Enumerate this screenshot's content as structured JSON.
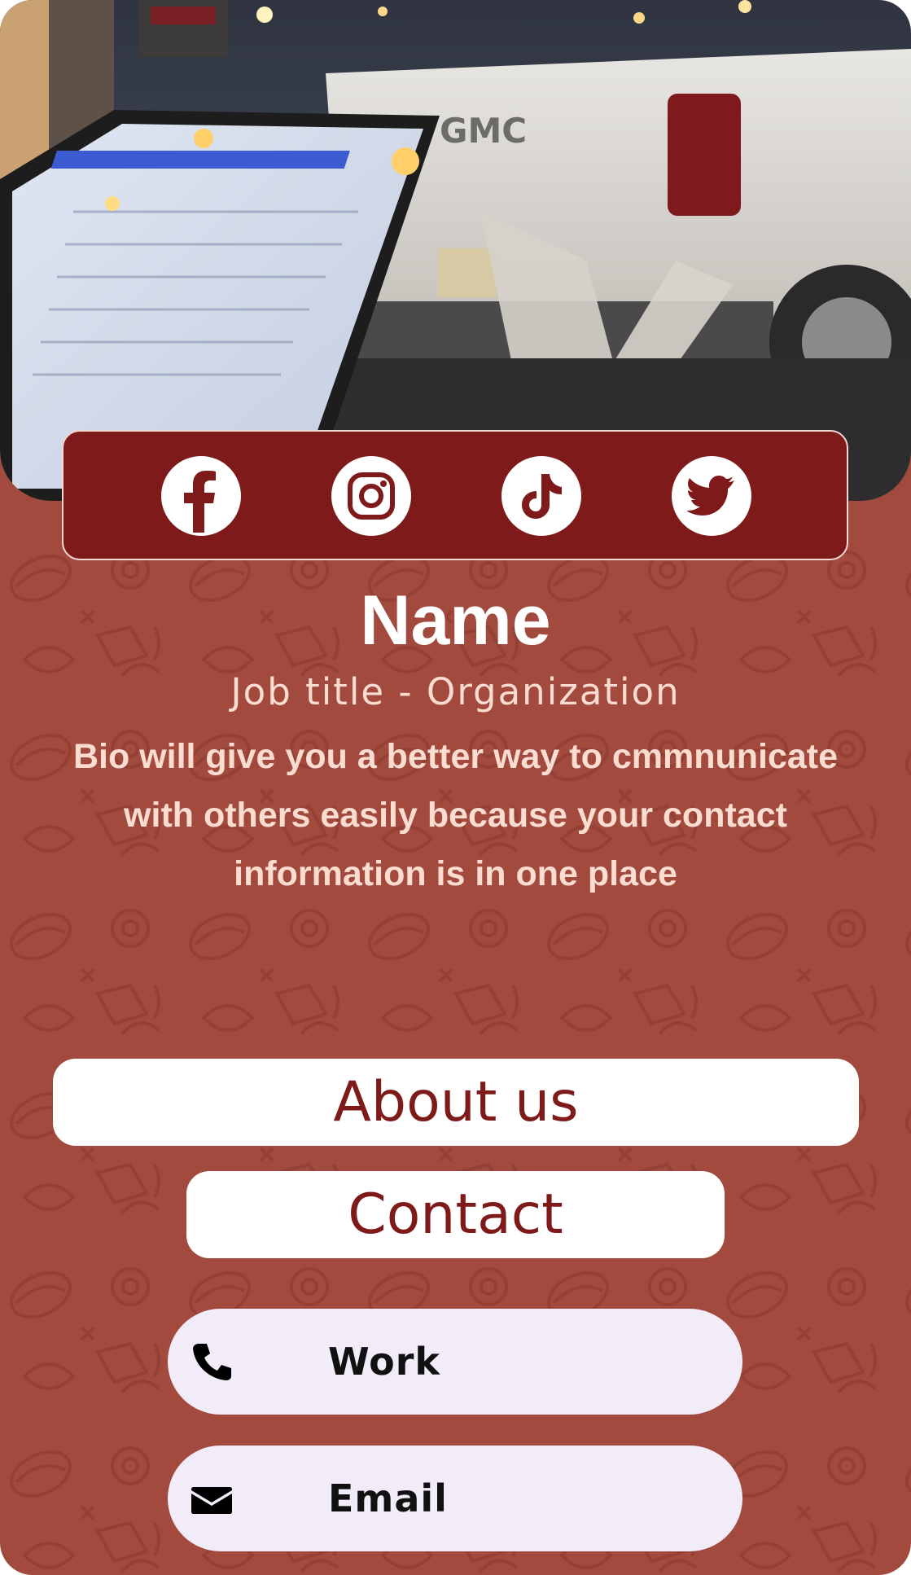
{
  "header": {
    "photo_icon": "header-photo",
    "social": [
      {
        "name": "facebook",
        "icon": "facebook-icon"
      },
      {
        "name": "instagram",
        "icon": "instagram-icon"
      },
      {
        "name": "tiktok",
        "icon": "tiktok-icon"
      },
      {
        "name": "twitter",
        "icon": "twitter-icon"
      }
    ]
  },
  "profile": {
    "name": "Name",
    "job_title": "Job title - Organization",
    "bio_lines": [
      "Bio will give you a better way to cmmnunicate",
      "with others easily because your contact",
      "information is in one place"
    ]
  },
  "buttons": {
    "about": "About us",
    "contact": "Contact"
  },
  "contacts": [
    {
      "label": "Work",
      "icon": "phone-icon"
    },
    {
      "label": "Email",
      "icon": "envelope-icon"
    }
  ],
  "colors": {
    "background": "#a34a3e",
    "accent": "#7e1a19",
    "text_light": "#fadcd0",
    "pill": "#f1ecf8"
  }
}
